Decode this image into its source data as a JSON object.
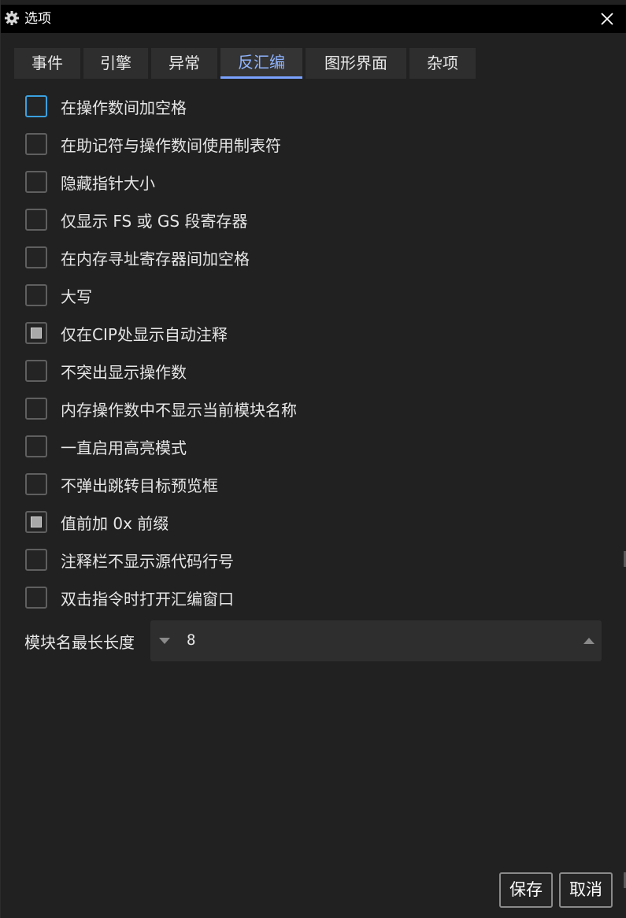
{
  "window": {
    "title": "选项",
    "icon": "gear-icon",
    "close_icon": "close-icon"
  },
  "tabs": [
    {
      "label": "事件",
      "active": false
    },
    {
      "label": "引擎",
      "active": false
    },
    {
      "label": "异常",
      "active": false
    },
    {
      "label": "反汇编",
      "active": true
    },
    {
      "label": "图形界面",
      "active": false
    },
    {
      "label": "杂项",
      "active": false
    }
  ],
  "options": [
    {
      "label": "在操作数间加空格",
      "checked": false,
      "focused": true
    },
    {
      "label": "在助记符与操作数间使用制表符",
      "checked": false
    },
    {
      "label": "隐藏指针大小",
      "checked": false
    },
    {
      "label": "仅显示 FS 或 GS 段寄存器",
      "checked": false
    },
    {
      "label": "在内存寻址寄存器间加空格",
      "checked": false
    },
    {
      "label": "大写",
      "checked": false
    },
    {
      "label": "仅在CIP处显示自动注释",
      "checked": true
    },
    {
      "label": "不突出显示操作数",
      "checked": false
    },
    {
      "label": "内存操作数中不显示当前模块名称",
      "checked": false
    },
    {
      "label": "一直启用高亮模式",
      "checked": false
    },
    {
      "label": "不弹出跳转目标预览框",
      "checked": false
    },
    {
      "label": "值前加 0x 前缀",
      "checked": true
    },
    {
      "label": "注释栏不显示源代码行号",
      "checked": false
    },
    {
      "label": "双击指令时打开汇编窗口",
      "checked": false
    }
  ],
  "module_name_length": {
    "label": "模块名最长长度",
    "value": "8"
  },
  "buttons": {
    "save": "保存",
    "cancel": "取消"
  },
  "colors": {
    "background": "#212121",
    "titlebar": "#000000",
    "active_tab_text": "#8fb4ff",
    "active_tab_underline": "#7aa2ff",
    "focus_border": "#3aa0e0"
  }
}
